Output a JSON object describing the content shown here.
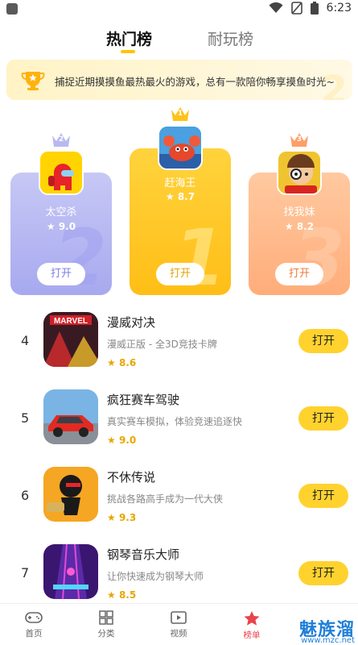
{
  "status_bar": {
    "time": "6:23"
  },
  "tabs": [
    {
      "label": "热门榜",
      "active": true
    },
    {
      "label": "耐玩榜",
      "active": false
    }
  ],
  "banner": {
    "text": "捕捉近期摸摸鱼最热最火的游戏，总有一款陪你畅享摸鱼时光~"
  },
  "podium": [
    {
      "rank": "2",
      "name": "太空杀",
      "rating": "9.0",
      "button": "打开",
      "icon": "among-us-icon"
    },
    {
      "rank": "1",
      "name": "赶海王",
      "rating": "8.7",
      "button": "打开",
      "icon": "crab-icon"
    },
    {
      "rank": "3",
      "name": "找我妹",
      "rating": "8.2",
      "button": "打开",
      "icon": "detective-icon"
    }
  ],
  "list": [
    {
      "rank": "4",
      "name": "漫威对决",
      "desc": "漫威正版 - 全3D竞技卡牌",
      "rating": "8.6",
      "button": "打开",
      "icon_text": "MARVEL"
    },
    {
      "rank": "5",
      "name": "疯狂赛车驾驶",
      "desc": "真实赛车模拟，体验竞速追逐快",
      "rating": "9.0",
      "button": "打开"
    },
    {
      "rank": "6",
      "name": "不休传说",
      "desc": "挑战各路高手成为一代大侠",
      "rating": "9.3",
      "button": "打开"
    },
    {
      "rank": "7",
      "name": "钢琴音乐大师",
      "desc": "让你快速成为钢琴大师",
      "rating": "8.5",
      "button": "打开"
    }
  ],
  "bottom_nav": [
    {
      "label": "首页",
      "icon": "gamepad-icon"
    },
    {
      "label": "分类",
      "icon": "grid-icon"
    },
    {
      "label": "视频",
      "icon": "video-icon"
    },
    {
      "label": "榜单",
      "icon": "star-icon",
      "active": true
    }
  ],
  "watermark": {
    "text": "魅族溜",
    "url": "www.mzc.net"
  },
  "colors": {
    "accent": "#ffd22e",
    "rating": "#e8a600",
    "nav_active": "#e9434c"
  }
}
